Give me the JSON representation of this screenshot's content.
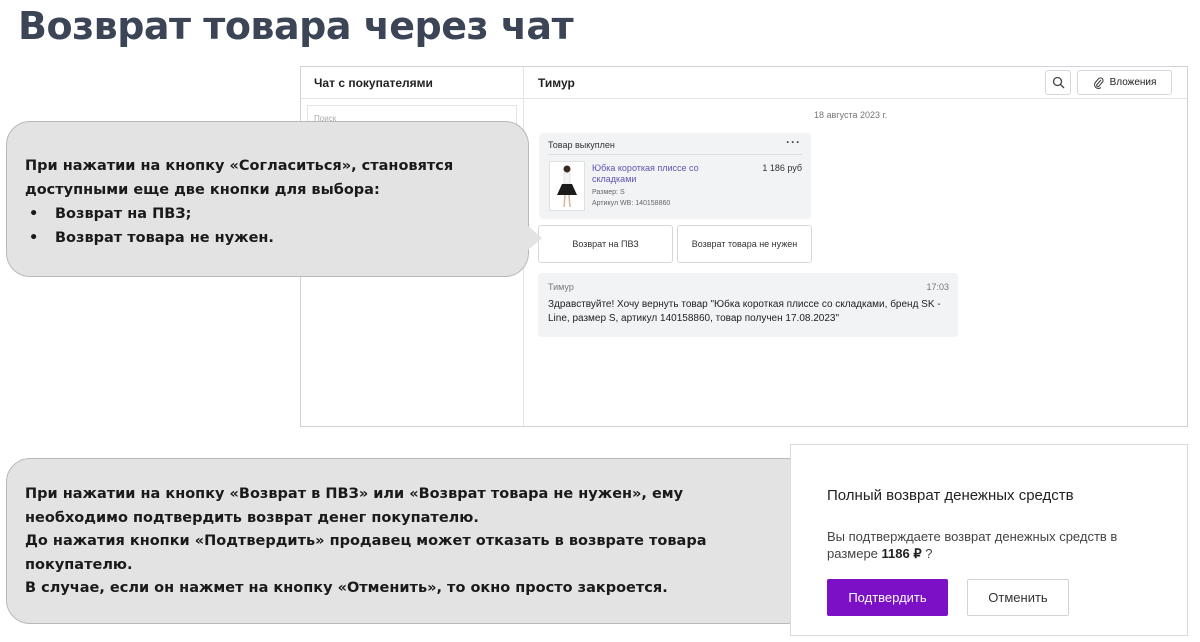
{
  "slide": {
    "title": "Возврат товара через чат"
  },
  "chat": {
    "sidebar_title": "Чат с покупателями",
    "search_placeholder": "Поиск",
    "user_name": "Тимур",
    "attach_label": "Вложения",
    "date": "18 августа 2023 г.",
    "order": {
      "status": "Товар выкуплен",
      "menu": "···",
      "product_name": "Юбка короткая плиссе со складками",
      "price": "1 186 руб",
      "size": "Размер: S",
      "article": "Артикул WB: 140158860"
    },
    "choices": {
      "return_pvz": "Возврат на ПВЗ",
      "return_not_needed": "Возврат товара не нужен"
    },
    "message": {
      "author": "Тимур",
      "time": "17:03",
      "text": "Здравствуйте! Хочу вернуть товар \"Юбка короткая плиссе со складками, бренд SK - Line, размер S, артикул 140158860, товар получен 17.08.2023\""
    }
  },
  "callout1": {
    "line1": "При нажатии на кнопку «Согласиться», становятся",
    "line2": "доступными еще две кнопки для выбора:",
    "bullets": [
      "Возврат на ПВЗ;",
      "Возврат товара не нужен."
    ]
  },
  "callout2": {
    "lines": [
      "При нажатии на кнопку «Возврат в ПВЗ» или «Возврат товара не нужен», ему",
      "необходимо подтвердить возврат денег покупателю.",
      "До нажатия кнопки «Подтвердить» продавец может отказать в возврате товара",
      "покупателю.",
      "В случае, если он нажмет на кнопку «Отменить», то окно просто закроется."
    ]
  },
  "refund_dialog": {
    "title": "Полный возврат денежных средств",
    "text_prefix": "Вы подтверждаете возврат денежных средств в размере ",
    "amount": "1186 ₽",
    "text_suffix": " ?",
    "confirm_label": "Подтвердить",
    "cancel_label": "Отменить"
  },
  "colors": {
    "accent": "#7b10c6",
    "link": "#5a55b0",
    "callout_bg": "#e3e3e3",
    "title": "#3c4556"
  }
}
